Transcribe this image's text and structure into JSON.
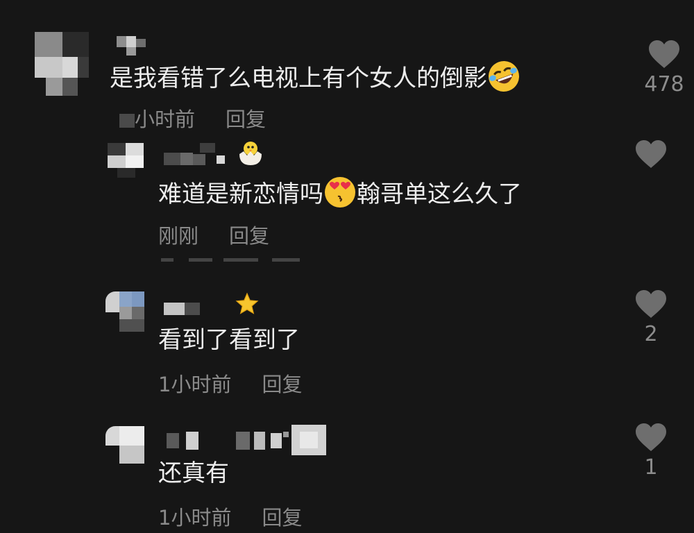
{
  "comments": [
    {
      "text": "是我看错了么电视上有个女人的倒影",
      "emoji": "rolling-laughing-emoji",
      "time": "小时前",
      "reply": "回复",
      "likes": "478"
    },
    {
      "text_before": "难道是新恋情吗",
      "emoji": "heart-eyes-emoji",
      "text_after": "翰哥单这么久了",
      "time": "刚刚",
      "reply": "回复",
      "badge": "hatching-chick-emoji"
    },
    {
      "text": "看到了看到了",
      "time": "1小时前",
      "reply": "回复",
      "likes": "2",
      "badge": "star-emoji"
    },
    {
      "text": "还真有",
      "time": "1小时前",
      "reply": "回复",
      "likes": "1"
    }
  ],
  "colors": {
    "background": "#161616",
    "text": "#ededed",
    "meta": "#8a8a8a",
    "heart": "#6e6e6e"
  }
}
